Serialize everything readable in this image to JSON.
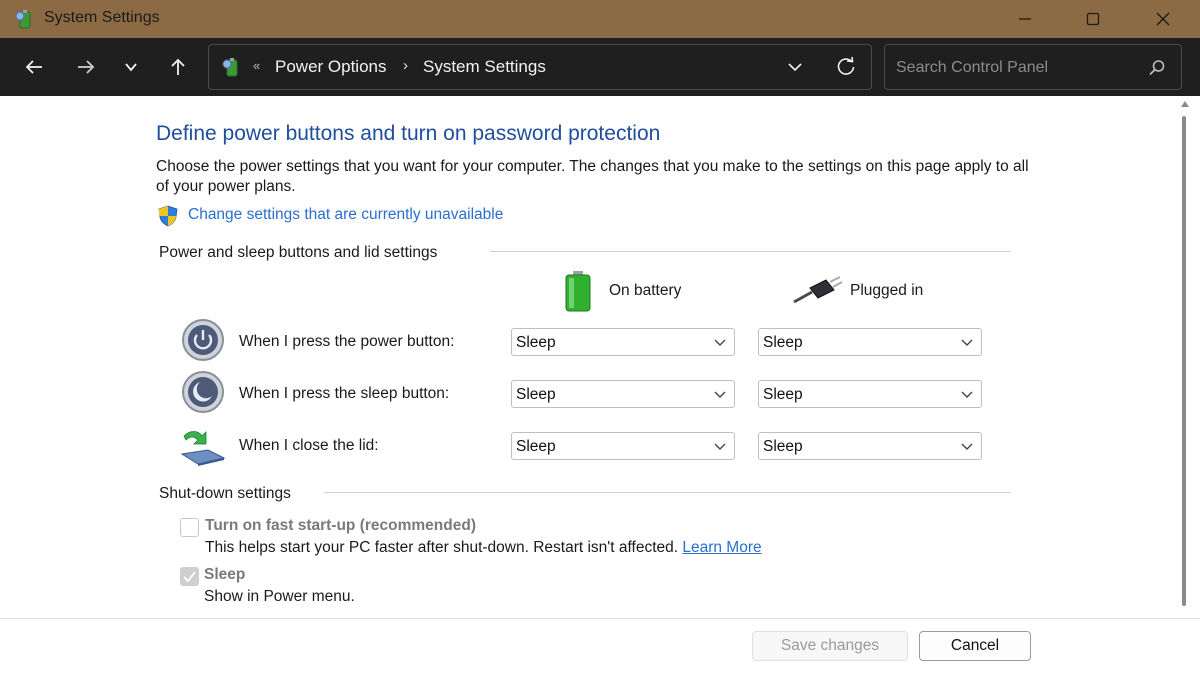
{
  "window": {
    "title": "System Settings",
    "minimize_label": "Minimize",
    "maximize_label": "Maximize",
    "close_label": "Close"
  },
  "nav": {
    "back_icon": "arrow-left-icon",
    "forward_icon": "arrow-right-icon",
    "recent_icon": "chevron-down-icon",
    "up_icon": "arrow-up-icon"
  },
  "address": {
    "overflow": "«",
    "crumbs": [
      "Power Options",
      "System Settings"
    ],
    "separator": "›"
  },
  "search": {
    "placeholder": "Search Control Panel"
  },
  "page": {
    "title": "Define power buttons and turn on password protection",
    "description": "Choose the power settings that you want for your computer. The changes that you make to the settings on this page apply to all of your power plans.",
    "change_link": "Change settings that are currently unavailable"
  },
  "buttons_section": {
    "header": "Power and sleep buttons and lid settings",
    "col_battery": "On battery",
    "col_plugged": "Plugged in",
    "rows": [
      {
        "label": "When I press the power button:",
        "battery": "Sleep",
        "plugged": "Sleep"
      },
      {
        "label": "When I press the sleep button:",
        "battery": "Sleep",
        "plugged": "Sleep"
      },
      {
        "label": "When I close the lid:",
        "battery": "Sleep",
        "plugged": "Sleep"
      }
    ]
  },
  "shutdown_section": {
    "header": "Shut-down settings",
    "items": [
      {
        "title": "Turn on fast start-up (recommended)",
        "desc": "This helps start your PC faster after shut-down. Restart isn't affected.",
        "link": "Learn More",
        "checked": false
      },
      {
        "title": "Sleep",
        "desc": "Show in Power menu.",
        "checked": true
      }
    ]
  },
  "footer": {
    "save": "Save changes",
    "cancel": "Cancel"
  },
  "colors": {
    "titlebar": "#8c6a43",
    "navbar": "#1f1f1f",
    "heading": "#1f4e9c",
    "link": "#2a6fd0"
  }
}
